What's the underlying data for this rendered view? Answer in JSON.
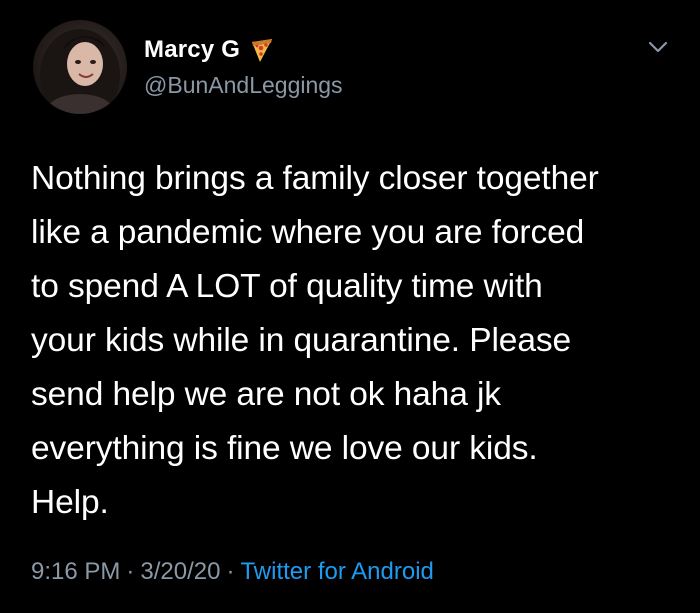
{
  "tweet": {
    "author": {
      "name": "Marcy G",
      "handle": "@BunAndLeggings",
      "name_emoji_icon": "pizza-icon"
    },
    "text": "Nothing brings a family closer together\nlike a pandemic where you are forced\nto spend A LOT of quality time with\nyour kids while in quarantine. Please\nsend help we are not ok haha jk\neverything is fine we love our kids.\nHelp.",
    "meta": {
      "time": "9:16 PM",
      "date": "3/20/20",
      "separator": "·",
      "source": "Twitter for Android"
    },
    "menu_icon": "chevron-down-icon"
  },
  "colors": {
    "background": "#000000",
    "primary_text": "#ffffff",
    "secondary_text": "#8b98a5",
    "link": "#1d9bf0"
  }
}
